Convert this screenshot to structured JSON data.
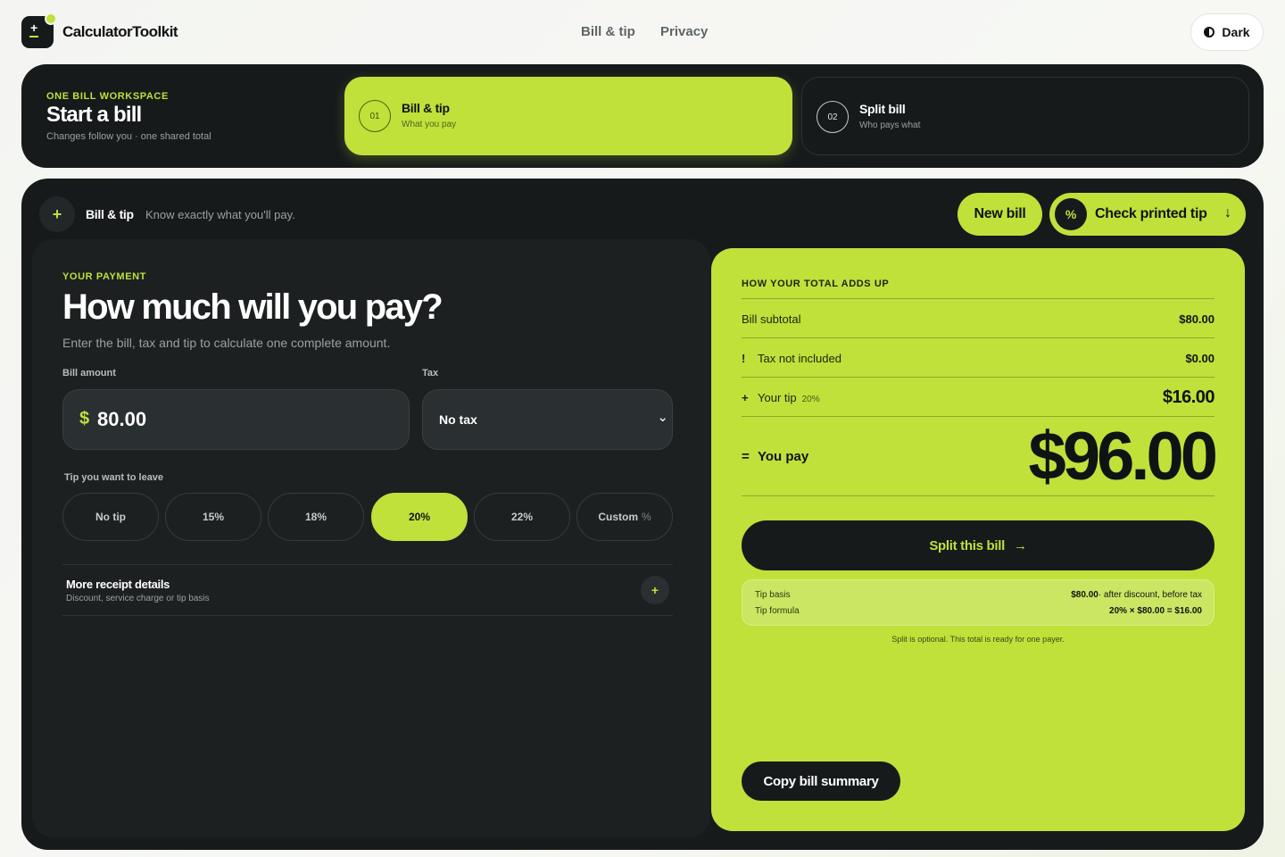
{
  "app": {
    "brand": "CalculatorToolkit",
    "nav": [
      "Bill & tip",
      "Privacy"
    ],
    "theme_label": "Dark"
  },
  "workspace": {
    "kicker": "ONE BILL WORKSPACE",
    "title": "Start a bill",
    "subtitle": "Changes follow you · one shared total",
    "steps": [
      {
        "num": "01",
        "title": "Bill & tip",
        "subtitle": "What you pay",
        "active": true
      },
      {
        "num": "02",
        "title": "Split bill",
        "subtitle": "Who pays what",
        "active": false
      }
    ]
  },
  "header": {
    "title": "Bill & tip",
    "subtitle": "Know exactly what you'll pay.",
    "new_bill": "New bill",
    "check_tip": "Check printed tip",
    "check_tip_icon": "%"
  },
  "payment": {
    "kicker": "YOUR PAYMENT",
    "title": "How much will you pay?",
    "subtitle": "Enter the bill, tax and tip to calculate one complete amount.",
    "bill_label": "Bill amount",
    "currency": "$",
    "bill_value": "80.00",
    "tax_label": "Tax",
    "tax_value": "No tax",
    "tip_label": "Tip you want to leave",
    "tip_options": [
      "No tip",
      "15%",
      "18%",
      "20%",
      "22%",
      "Custom"
    ],
    "tip_custom_suffix": "%",
    "selected_tip": "20%",
    "receipt_title": "More receipt details",
    "receipt_subtitle": "Discount, service charge or tip basis"
  },
  "summary": {
    "kicker": "HOW YOUR TOTAL ADDS UP",
    "subtotal_label": "Bill subtotal",
    "subtotal_value": "$80.00",
    "tax_symbol": "!",
    "tax_label": "Tax not included",
    "tax_value": "$0.00",
    "tip_symbol": "+",
    "tip_label": "Your tip",
    "tip_badge": "20%",
    "tip_value": "$16.00",
    "total_symbol": "=",
    "total_label": "You pay",
    "total_value": "$96.00",
    "split_button": "Split this bill",
    "split_arrow": "→",
    "tip_basis_label": "Tip basis",
    "tip_basis_value": "$80.00",
    "tip_basis_note": "· after discount, before tax",
    "tip_formula_label": "Tip formula",
    "tip_formula_value": "20% × $80.00 = $16.00",
    "note": "Split is optional. This total is ready for one payer.",
    "copy_button": "Copy bill summary"
  },
  "colors": {
    "accent": "#bfe13a",
    "dark": "#161a1b",
    "panel": "#1c2021"
  }
}
